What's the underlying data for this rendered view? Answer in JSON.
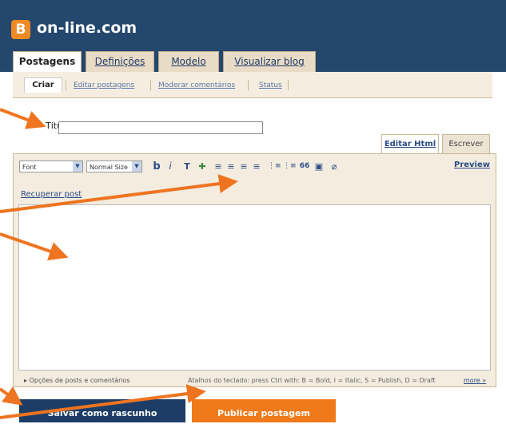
{
  "header": {
    "logo_letter": "B",
    "site_title": "on-line.com",
    "tabs": [
      {
        "label": "Postagens"
      },
      {
        "label": "Definições"
      },
      {
        "label": "Modelo"
      },
      {
        "label": "Visualizar blog"
      }
    ],
    "subtabs": [
      {
        "label": "Criar"
      },
      {
        "label": "Editar postagens"
      },
      {
        "label": "Moderar comentários"
      },
      {
        "label": "Status"
      }
    ]
  },
  "editor": {
    "title_label": "Título:",
    "title_value": "",
    "mode_tabs": {
      "html": "Editar Html",
      "write": "Escrever"
    },
    "font_select": "Font",
    "size_select": "Normal Size",
    "toolbar": {
      "bold": "b",
      "italic": "i",
      "text_color": "T",
      "link": "✚",
      "align_left": "≡",
      "align_center": "≡",
      "align_right": "≡",
      "justify": "≡",
      "numbered_list": "⋮≡",
      "bulleted_list": "⋮≡",
      "quote": "66",
      "image": "▣",
      "eraser": "⌀"
    },
    "preview": "Preview",
    "recover_post": "Recuperar post",
    "options": "Opções de posts e comentários",
    "shortcuts": "Atalhos do teclado: press Ctrl with: B = Bold, I = Italic, S = Publish, D = Draft",
    "more": "more »"
  },
  "buttons": {
    "save_draft": "Salvar como rascunho",
    "publish": "Publicar postagem"
  },
  "colors": {
    "header_bg": "#24476e",
    "accent_orange": "#ef7a1a",
    "arrow": "#ee7420"
  }
}
